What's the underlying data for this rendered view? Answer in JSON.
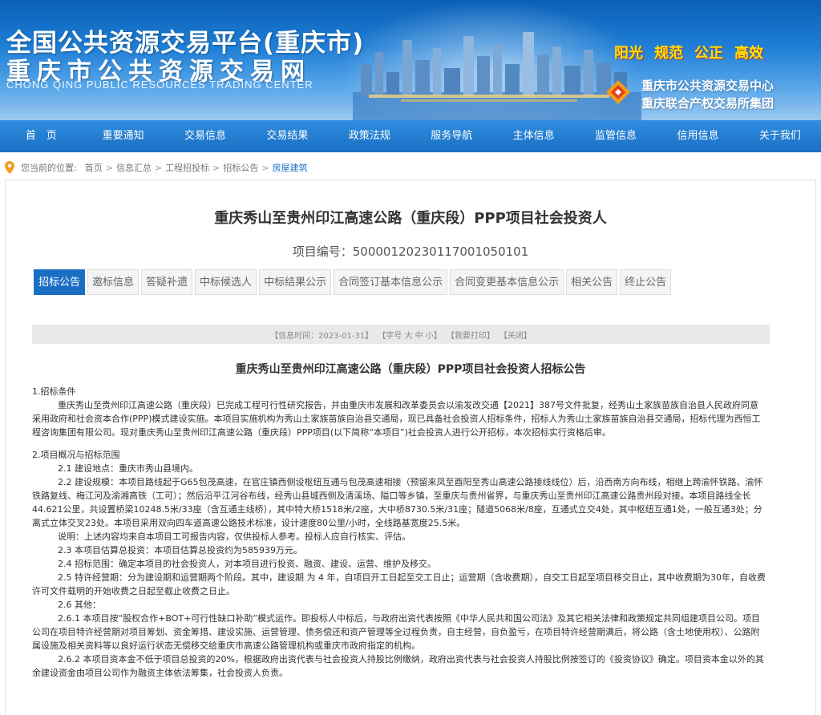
{
  "header": {
    "title_main": "全国公共资源交易平台(重庆市)",
    "title_sub": "重庆市公共资源交易网",
    "title_en": "CHONG QING PUBLIC RESOURCES TRADING CENTER",
    "slogans": [
      "阳光",
      "规范",
      "公正",
      "高效"
    ],
    "org_line1": "重庆市公共资源交易中心",
    "org_line2": "重庆联合产权交易所集团"
  },
  "nav": {
    "items": [
      "首　页",
      "重要通知",
      "交易信息",
      "交易结果",
      "政策法规",
      "服务导航",
      "主体信息",
      "监管信息",
      "信用信息",
      "关于我们"
    ]
  },
  "breadcrumb": {
    "prefix": "您当前的位置:",
    "items": [
      "首页",
      "信息汇总",
      "工程招投标",
      "招标公告",
      "房屋建筑"
    ],
    "separator": ">"
  },
  "project": {
    "title": "重庆秀山至贵州印江高速公路（重庆段）PPP项目社会投资人",
    "code_label": "项目编号：",
    "code": "500001202301170010501​01"
  },
  "tabs": [
    {
      "label": "招标公告",
      "active": true
    },
    {
      "label": "邀标信息",
      "active": false
    },
    {
      "label": "答疑补遗",
      "active": false
    },
    {
      "label": "中标候选人",
      "active": false
    },
    {
      "label": "中标结果公示",
      "active": false
    },
    {
      "label": "合同签订基本信息公示",
      "active": false
    },
    {
      "label": "合同变更基本信息公示",
      "active": false
    },
    {
      "label": "相关公告",
      "active": false
    },
    {
      "label": "终止公告",
      "active": false
    }
  ],
  "infobar": {
    "time": "【信息时间：2023-01-31】",
    "font": "【字号 大 中 小】",
    "print": "【我要打印】",
    "close": "【关闭】"
  },
  "notice": {
    "title": "重庆秀山至贵州印江高速公路（重庆段）PPP项目社会投资人招标公告",
    "sec1_head": "1.招标条件",
    "sec1_body": "重庆秀山至贵州印江高速公路（重庆段）已完成工程可行性研究报告，并由重庆市发展和改革委员会以渝发改交通【2021】387号文件批复，经秀山土家族苗族自治县人民政府同意采用政府和社会资本合作(PPP)模式建设实施。本项目实施机构为秀山土家族苗族自治县交通局，现已具备社会投资人招标条件，招标人为秀山土家族苗族自治县交通局，招标代理为西恒工程咨询集团有限公司。现对重庆秀山至贵州印江高速公路（重庆段）PPP项目(以下简称“本项目”)社会投资人进行公开招标，本次招标实行资格后审。",
    "sec2_head": "2.项目概况与招标范围",
    "s2_1": "2.1 建设地点：重庆市秀山县境内。",
    "s2_2": "2.2 建设规模：本项目路线起于G65包茂高速，在官庄镇西侧设枢纽互通与包茂高速相接（预留来凤至酉阳至秀山高速公路接线线位）后，沿西南方向布线，相继上跨渝怀铁路、渝怀铁路复线、梅江河及渝湘高铁（工可）；然后沿平江河谷布线，经秀山县城西侧及清溪场、隘口等乡镇，至重庆与贵州省界，与重庆秀山至贵州印江高速公路贵州段对接。本项目路线全长44.621公里，共设置桥梁10248.5米/33座（含互通主线桥），其中特大桥1518米/2座，大中桥8730.5米/31座；隧道5068米/8座，互通式立交4处，其中枢纽互通1处，一般互通3处；分离式立体交叉23处。本项目采用双向四车道高速公路技术标准，设计速度80公里/小时，全线路基宽度25.5米。",
    "s2_note": "说明：上述内容均来自本项目工可报告内容，仅供投标人参考。投标人应自行核实、评估。",
    "s2_3": "2.3 本项目估算总投资：本项目估算总投资约为585939万元。",
    "s2_4": "2.4 招标范围：确定本项目的社会投资人，对本项目进行投资、融资、建设、运营、维护及移交。",
    "s2_5": "2.5 特许经营期：分为建设期和运营期两个阶段。其中，建设期 为 4 年，自项目开工日起至交工日止；运营期（含收费期），自交工日起至项目移交日止，其中收费期为30年，自收费许可文件载明的开始收费之日起至截止收费之日止。",
    "s2_6": "2.6 其他：",
    "s2_6_1": "2.6.1 本项目按“股权合作+BOT+可行性缺口补助”模式运作。即投标人中标后，与政府出资代表按照《中华人民共和国公司法》及其它相关法律和政策规定共同组建项目公司。项目公司在项目特许经营期对项目筹划、资金筹措、建设实施、运营管理、债务偿还和资产管理等全过程负责，自主经营，自负盈亏，在项目特许经营期满后，将公路（含土地使用权）、公路附属设施及相关资料等以良好运行状态无偿移交给重庆市高速公路管理机构或重庆市政府指定的机构。",
    "s2_6_2": "2.6.2 本项目资本金不低于项目总投资的20%，根据政府出资代表与社会投资人持股比例缴纳，政府出资代表与社会投资人持股比例按签订的《投资协议》确定。项目资本金以外的其余建设资金由项目公司作为融资主体依法筹集，社会投资人负责。"
  },
  "colors": {
    "brand_blue": "#1a6fc4",
    "slogan_yellow": "#ffe100",
    "pin_orange": "#f29b1d"
  },
  "icons": {
    "location": "location-pin-icon",
    "logo": "trading-center-logo-icon"
  }
}
